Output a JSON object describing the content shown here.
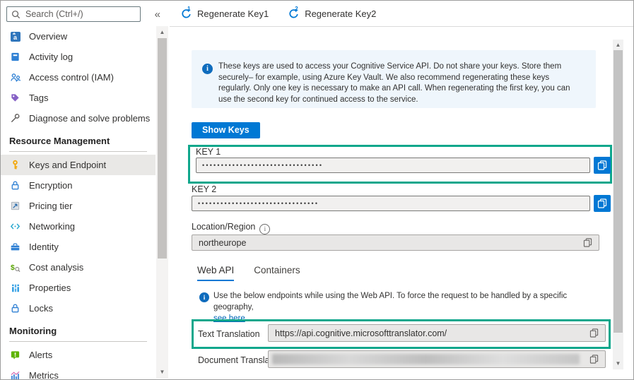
{
  "sidebar": {
    "search_placeholder": "Search (Ctrl+/)",
    "collapse_glyph": "«",
    "sections": [
      {
        "items": [
          {
            "label": "Overview",
            "icon": "translator-icon"
          },
          {
            "label": "Activity log",
            "icon": "activity-log-icon"
          },
          {
            "label": "Access control (IAM)",
            "icon": "access-control-icon"
          },
          {
            "label": "Tags",
            "icon": "tags-icon"
          },
          {
            "label": "Diagnose and solve problems",
            "icon": "diagnose-icon"
          }
        ]
      },
      {
        "header": "Resource Management",
        "items": [
          {
            "label": "Keys and Endpoint",
            "icon": "key-icon",
            "selected": true
          },
          {
            "label": "Encryption",
            "icon": "lock-icon"
          },
          {
            "label": "Pricing tier",
            "icon": "pricing-icon"
          },
          {
            "label": "Networking",
            "icon": "networking-icon"
          },
          {
            "label": "Identity",
            "icon": "identity-icon"
          },
          {
            "label": "Cost analysis",
            "icon": "cost-analysis-icon"
          },
          {
            "label": "Properties",
            "icon": "properties-icon"
          },
          {
            "label": "Locks",
            "icon": "lock-icon"
          }
        ]
      },
      {
        "header": "Monitoring",
        "items": [
          {
            "label": "Alerts",
            "icon": "alerts-icon"
          },
          {
            "label": "Metrics",
            "icon": "metrics-icon"
          }
        ]
      }
    ]
  },
  "toolbar": {
    "buttons": [
      {
        "label": "Regenerate Key1",
        "badge": "1",
        "icon": "refresh-icon"
      },
      {
        "label": "Regenerate Key2",
        "badge": "2",
        "icon": "refresh-icon"
      }
    ]
  },
  "content": {
    "banner": {
      "text": "These keys are used to access your Cognitive Service API. Do not share your keys. Store them securely– for example, using Azure Key Vault. We also recommend regenerating these keys regularly. Only one key is necessary to make an API call. When regenerating the first key, you can use the second key for continued access to the service."
    },
    "show_keys": "Show Keys",
    "fields": {
      "key1": {
        "label": "KEY 1",
        "value": "••••••••••••••••••••••••••••••••"
      },
      "key2": {
        "label": "KEY 2",
        "value": "••••••••••••••••••••••••••••••••"
      },
      "location": {
        "label": "Location/Region",
        "value": "northeurope"
      }
    },
    "tabs": [
      {
        "label": "Web API"
      },
      {
        "label": "Containers"
      }
    ],
    "endpoint_note": {
      "text": "Use the below endpoints while using the Web API. To force the request to be handled by a specific geography,",
      "link": "see here",
      "suffix": "."
    },
    "endpoints": {
      "text_translation": {
        "label": "Text Translation",
        "value": "https://api.cognitive.microsofttranslator.com/"
      },
      "document_translation": {
        "label": "Document Translation",
        "value": ""
      }
    }
  },
  "colors": {
    "accent": "#0078d4",
    "callout_border": "#10a78c",
    "banner_bg": "#eff6fc",
    "link": "#0067b8",
    "selected_item_bg": "#e9e8e6"
  }
}
